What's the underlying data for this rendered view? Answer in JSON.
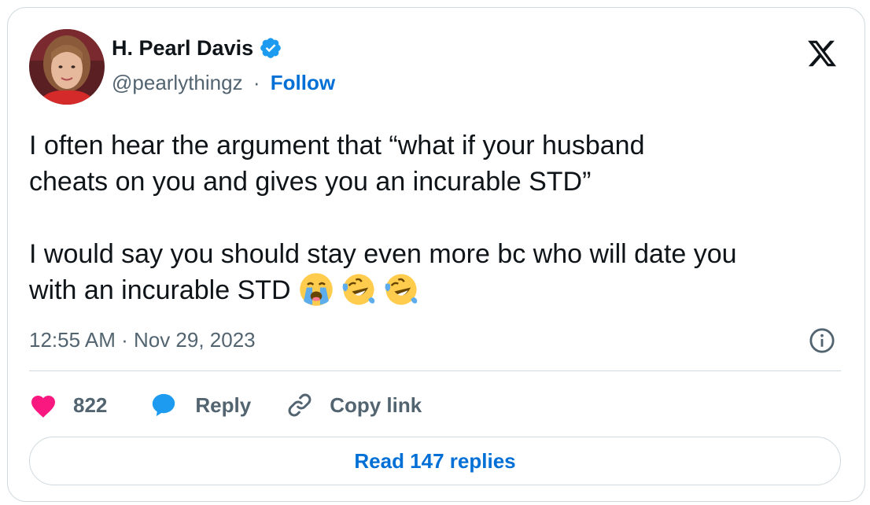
{
  "author": {
    "name": "H. Pearl Davis",
    "handle": "@pearlythingz",
    "separator": "·",
    "follow_label": "Follow",
    "verified": true,
    "verified_color": "#1d9bf0"
  },
  "tweet": {
    "line1": "I often hear the argument that “what if your husband",
    "line2": "cheats on you and gives you an incurable STD”",
    "line3": "I would say you should stay even more bc who will date you",
    "line4": "with an incurable STD",
    "emojis": [
      "loudly-crying-face",
      "rolling-on-the-floor-laughing",
      "rolling-on-the-floor-laughing"
    ]
  },
  "timestamp": "12:55 AM · Nov 29, 2023",
  "actions": {
    "likes": "822",
    "reply_label": "Reply",
    "copy_label": "Copy link"
  },
  "read_replies_label": "Read 147 replies",
  "colors": {
    "like": "#f91880",
    "reply": "#1d9bf0",
    "link": "#006fd6",
    "muted": "#536471",
    "border": "#cfd9de"
  },
  "icons": {
    "brand": "x-logo",
    "info": "info-icon",
    "like": "heart-icon",
    "reply": "speech-bubble-icon",
    "copy": "link-icon"
  }
}
